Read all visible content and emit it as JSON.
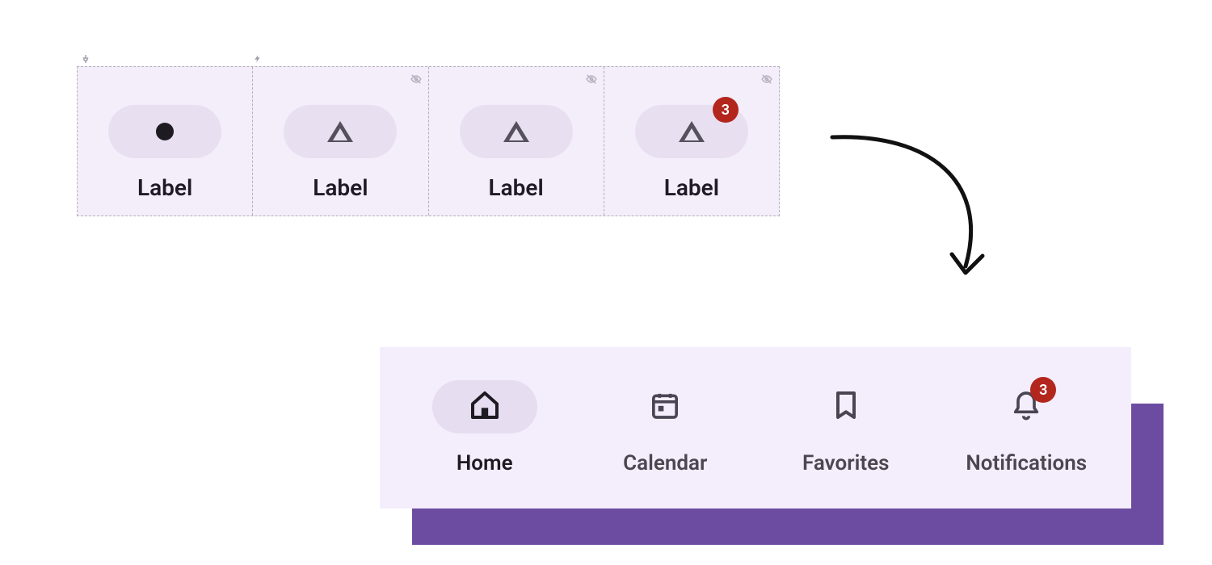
{
  "spec": {
    "items": [
      {
        "label": "Label",
        "icon": "dot",
        "active": true,
        "hidden_marker": false,
        "badge": null
      },
      {
        "label": "Label",
        "icon": "triangle",
        "active": false,
        "hidden_marker": true,
        "badge": null
      },
      {
        "label": "Label",
        "icon": "triangle",
        "active": false,
        "hidden_marker": true,
        "badge": null
      },
      {
        "label": "Label",
        "icon": "triangle",
        "active": false,
        "hidden_marker": true,
        "badge": "3"
      }
    ]
  },
  "nav": {
    "items": [
      {
        "label": "Home",
        "icon": "home",
        "active": true,
        "badge": null
      },
      {
        "label": "Calendar",
        "icon": "calendar",
        "active": false,
        "badge": null
      },
      {
        "label": "Favorites",
        "icon": "bookmark",
        "active": false,
        "badge": null
      },
      {
        "label": "Notifications",
        "icon": "bell",
        "active": false,
        "badge": "3"
      }
    ]
  },
  "colors": {
    "surface": "#f4eefc",
    "pill_active": "#e6ddf0",
    "badge": "#b3261e",
    "shadow": "#6c4ca1"
  }
}
